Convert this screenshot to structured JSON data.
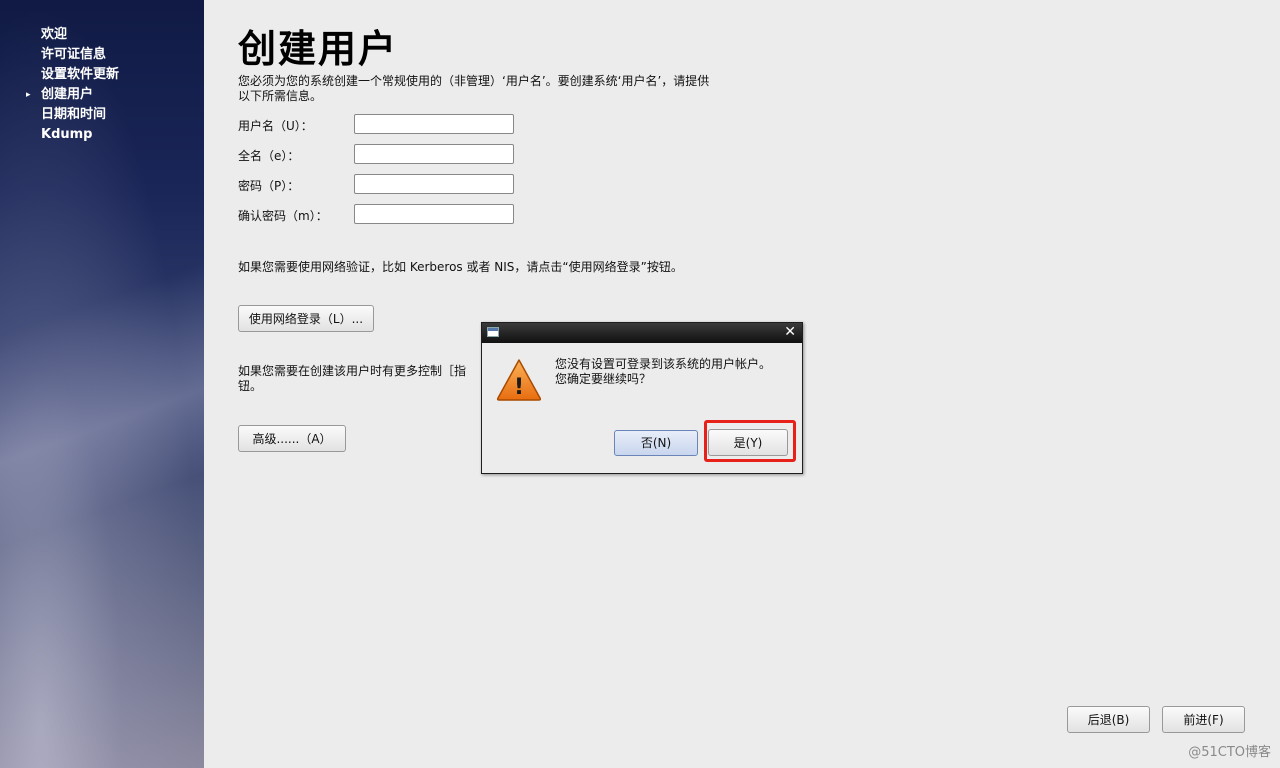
{
  "sidebar": {
    "items": [
      {
        "label": "欢迎"
      },
      {
        "label": "许可证信息"
      },
      {
        "label": "设置软件更新"
      },
      {
        "label": "创建用户",
        "marker": "▸",
        "current": true
      },
      {
        "label": "日期和时间"
      },
      {
        "label": "Kdump"
      }
    ]
  },
  "main": {
    "title": "创建用户",
    "intro": "您必须为您的系统创建一个常规使用的（非管理）‘用户名’。要创建系统‘用户名’，请提供以下所需信息。",
    "fields": [
      {
        "label": "用户名（U）：",
        "value": ""
      },
      {
        "label": "全名（e）：",
        "value": ""
      },
      {
        "label": "密码（P）：",
        "value": ""
      },
      {
        "label": "确认密码（m）：",
        "value": ""
      }
    ],
    "network_hint": "如果您需要使用网络验证，比如 Kerberos 或者 NIS，请点击“使用网络登录”按钮。",
    "network_login_label": "使用网络登录（L）...",
    "advanced_hint": "如果您需要在创建该用户时有更多控制［指",
    "advanced_hint_tail": "钮。",
    "advanced_label": "高级......（A）"
  },
  "footer": {
    "back_label": "后退(B)",
    "forward_label": "前进(F)"
  },
  "dialog": {
    "message_line1": "您没有设置可登录到该系统的用户帐户。",
    "message_line2": "您确定要继续吗？",
    "close_glyph": "✕",
    "warning_glyph": "!",
    "no_label": "否(N)",
    "yes_label": "是(Y)",
    "highlight_color": "#e8201a"
  },
  "watermark": "@51CTO博客"
}
